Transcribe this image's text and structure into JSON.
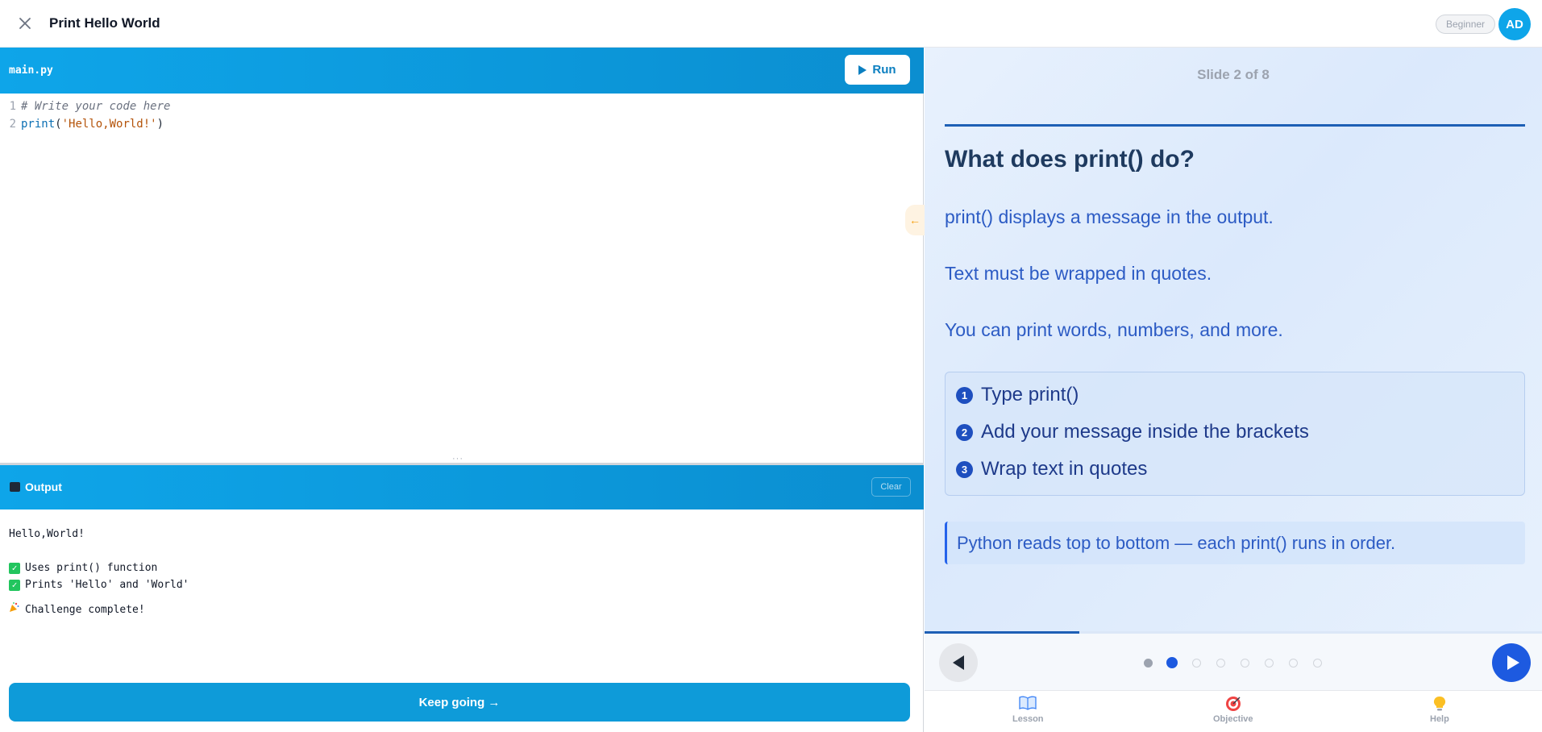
{
  "header": {
    "title": "Print Hello World",
    "level": "Beginner",
    "avatar_initials": "AD"
  },
  "editor": {
    "file_name": "main.py",
    "run_label": "Run",
    "lines": [
      {
        "num": "1",
        "comment": "# Write your code here"
      },
      {
        "num": "2",
        "func": "print",
        "open": "(",
        "string": "'Hello,World!'",
        "close": ")"
      }
    ]
  },
  "output": {
    "title": "Output",
    "clear_label": "Clear",
    "result": "Hello,World!",
    "checks": [
      "Uses print() function",
      "Prints 'Hello' and 'World'"
    ],
    "complete_message": "Challenge complete!"
  },
  "keep_going_label": "Keep going →",
  "slide": {
    "counter": "Slide 2 of 8",
    "current": 2,
    "total": 8,
    "heading": "What does print() do?",
    "paragraphs": [
      "print() displays a message in the output.",
      "Text must be wrapped in quotes.",
      "You can print words, numbers, and more."
    ],
    "steps": [
      {
        "num": "1",
        "text": "Type print()"
      },
      {
        "num": "2",
        "text": "Add your message inside the brackets"
      },
      {
        "num": "3",
        "text": "Wrap text in quotes"
      }
    ],
    "tip": "Python reads top to bottom — each print() runs in order.",
    "progress_fraction": 0.25
  },
  "tabs": [
    {
      "label": "Lesson",
      "icon": "book-icon"
    },
    {
      "label": "Objective",
      "icon": "target-icon"
    },
    {
      "label": "Help",
      "icon": "lightbulb-icon"
    }
  ],
  "colors": {
    "accent": "#0ea5e9",
    "slide_accent": "#1d5ae0"
  }
}
